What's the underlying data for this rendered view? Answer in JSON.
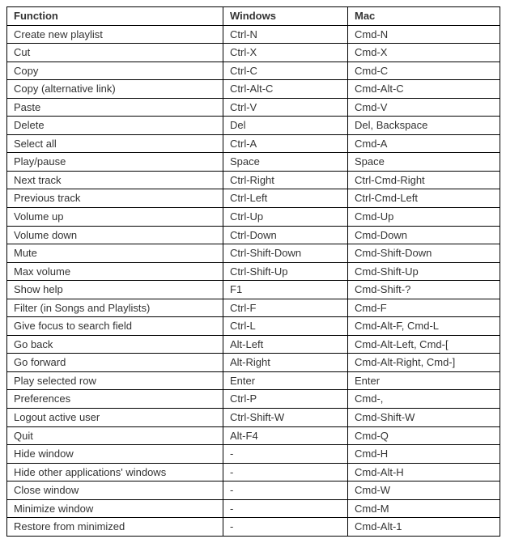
{
  "table": {
    "headers": [
      "Function",
      "Windows",
      "Mac"
    ],
    "rows": [
      {
        "function": "Create new playlist",
        "windows": "Ctrl-N",
        "mac": "Cmd-N"
      },
      {
        "function": "Cut",
        "windows": "Ctrl-X",
        "mac": "Cmd-X"
      },
      {
        "function": "Copy",
        "windows": "Ctrl-C",
        "mac": "Cmd-C"
      },
      {
        "function": "Copy (alternative link)",
        "windows": "Ctrl-Alt-C",
        "mac": "Cmd-Alt-C"
      },
      {
        "function": "Paste",
        "windows": "Ctrl-V",
        "mac": "Cmd-V"
      },
      {
        "function": "Delete",
        "windows": "Del",
        "mac": "Del, Backspace"
      },
      {
        "function": "Select all",
        "windows": "Ctrl-A",
        "mac": "Cmd-A"
      },
      {
        "function": "Play/pause",
        "windows": "Space",
        "mac": "Space"
      },
      {
        "function": "Next track",
        "windows": "Ctrl-Right",
        "mac": "Ctrl-Cmd-Right"
      },
      {
        "function": "Previous track",
        "windows": "Ctrl-Left",
        "mac": "Ctrl-Cmd-Left"
      },
      {
        "function": "Volume up",
        "windows": "Ctrl-Up",
        "mac": "Cmd-Up"
      },
      {
        "function": "Volume down",
        "windows": "Ctrl-Down",
        "mac": "Cmd-Down"
      },
      {
        "function": "Mute",
        "windows": "Ctrl-Shift-Down",
        "mac": "Cmd-Shift-Down"
      },
      {
        "function": "Max volume",
        "windows": "Ctrl-Shift-Up",
        "mac": "Cmd-Shift-Up"
      },
      {
        "function": "Show help",
        "windows": "F1",
        "mac": "Cmd-Shift-?"
      },
      {
        "function": "Filter (in Songs and Playlists)",
        "windows": "Ctrl-F",
        "mac": "Cmd-F"
      },
      {
        "function": "Give focus to search field",
        "windows": "Ctrl-L",
        "mac": "Cmd-Alt-F, Cmd-L"
      },
      {
        "function": "Go back",
        "windows": "Alt-Left",
        "mac": "Cmd-Alt-Left, Cmd-["
      },
      {
        "function": "Go forward",
        "windows": "Alt-Right",
        "mac": "Cmd-Alt-Right, Cmd-]"
      },
      {
        "function": "Play selected row",
        "windows": "Enter",
        "mac": "Enter"
      },
      {
        "function": "Preferences",
        "windows": "Ctrl-P",
        "mac": "Cmd-,"
      },
      {
        "function": "Logout active user",
        "windows": "Ctrl-Shift-W",
        "mac": "Cmd-Shift-W"
      },
      {
        "function": "Quit",
        "windows": "Alt-F4",
        "mac": "Cmd-Q"
      },
      {
        "function": "Hide window",
        "windows": "-",
        "mac": "Cmd-H"
      },
      {
        "function": "Hide other applications' windows",
        "windows": "-",
        "mac": "Cmd-Alt-H"
      },
      {
        "function": "Close window",
        "windows": "-",
        "mac": "Cmd-W"
      },
      {
        "function": "Minimize window",
        "windows": "-",
        "mac": "Cmd-M"
      },
      {
        "function": "Restore from minimized",
        "windows": "-",
        "mac": "Cmd-Alt-1"
      }
    ]
  }
}
